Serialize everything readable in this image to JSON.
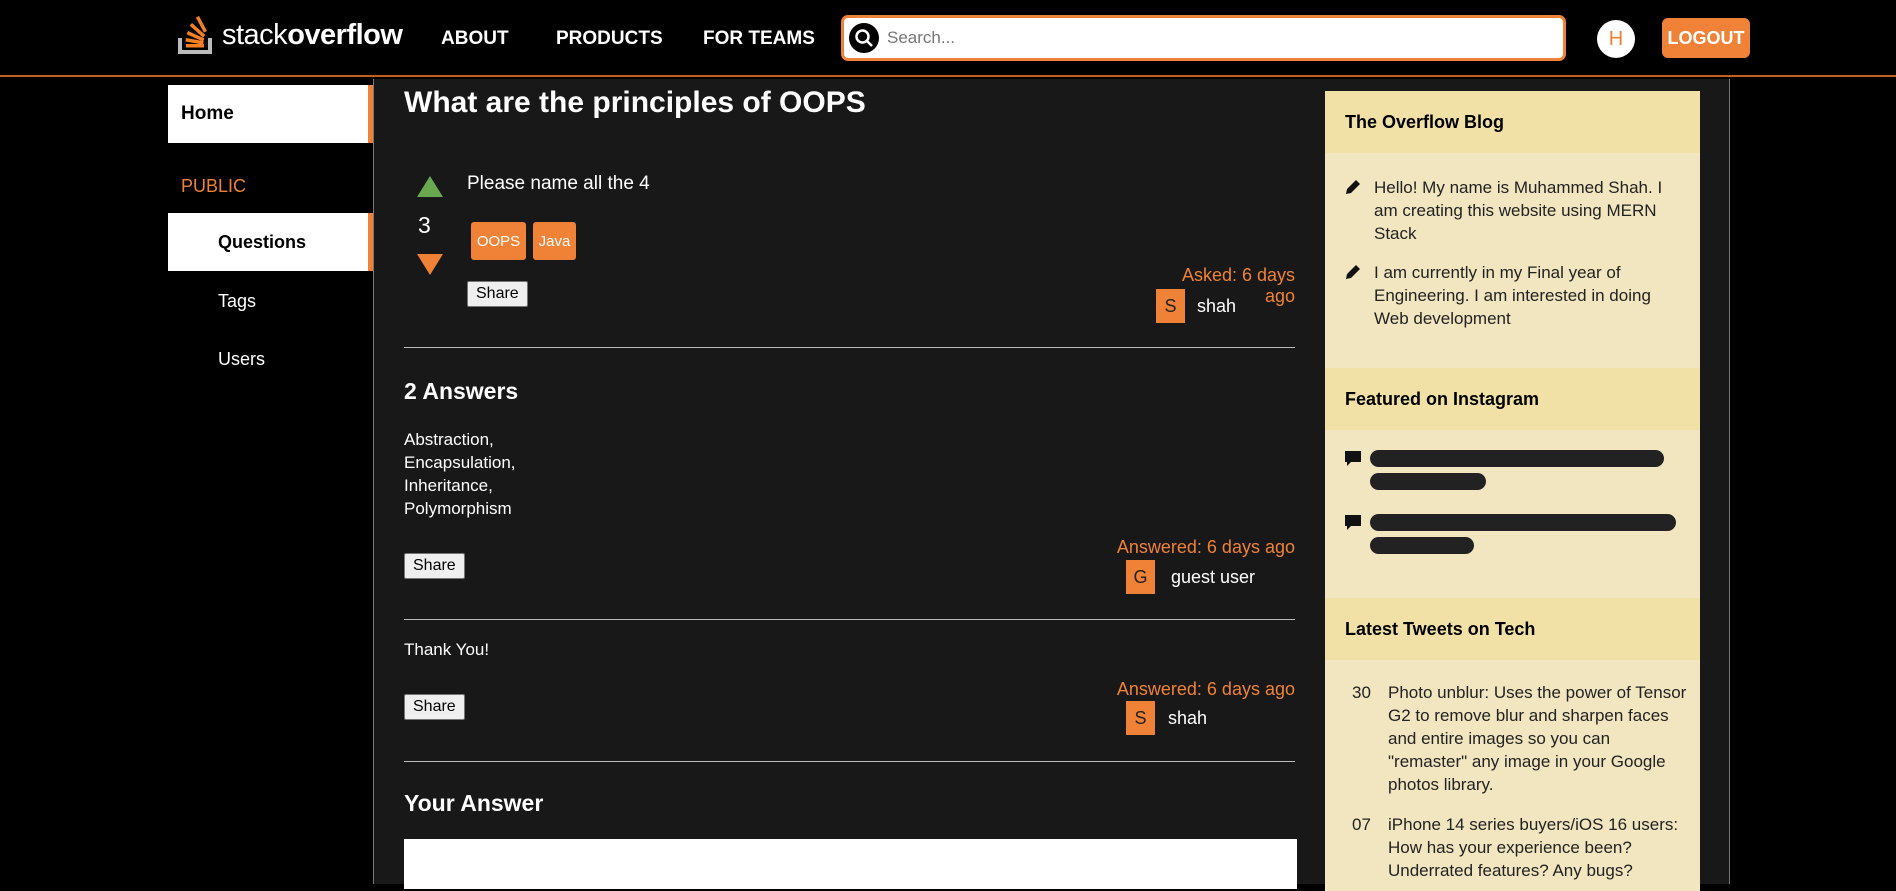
{
  "header": {
    "logo_light": "stack",
    "logo_bold": "overflow",
    "nav": [
      "ABOUT",
      "PRODUCTS",
      "FOR TEAMS"
    ],
    "search_placeholder": "Search...",
    "avatar_letter": "H",
    "logout_label": "LOGOUT"
  },
  "sidebar": {
    "home": "Home",
    "public": "PUBLIC",
    "questions": "Questions",
    "tags": "Tags",
    "users": "Users"
  },
  "question": {
    "title": "What are the principles of OOPS",
    "votes": "3",
    "body": "Please name all the 4",
    "tags": [
      "OOPS",
      "Java"
    ],
    "share_label": "Share",
    "asked": "Asked: 6 days ago",
    "author_initial": "S",
    "author": "shah"
  },
  "answers": {
    "heading": "2 Answers",
    "items": [
      {
        "lines": [
          "Abstraction,",
          "Encapsulation,",
          "Inheritance,",
          "Polymorphism"
        ],
        "share_label": "Share",
        "answered": "Answered: 6 days ago",
        "author_initial": "G",
        "author": "guest user"
      },
      {
        "lines": [
          "Thank You!"
        ],
        "share_label": "Share",
        "answered": "Answered: 6 days ago",
        "author_initial": "S",
        "author": "shah"
      }
    ]
  },
  "your_answer": {
    "heading": "Your Answer"
  },
  "right_sidebar": {
    "blog_heading": "The Overflow Blog",
    "blog_items": [
      "Hello! My name is Muhammed Shah. I am creating this website using MERN Stack",
      "I am currently in my Final year of Engineering. I am interested in doing Web development"
    ],
    "instagram_heading": "Featured on Instagram",
    "tweets_heading": "Latest Tweets on Tech",
    "tweets": [
      {
        "num": "30",
        "text": "Photo unblur: Uses the power of Tensor G2 to remove blur and sharpen faces and entire images so you can \"remaster\" any image in your Google photos library."
      },
      {
        "num": "07",
        "text": "iPhone 14 series buyers/iOS 16 users: How has your experience been? Underrated features? Any bugs?"
      }
    ]
  },
  "colors": {
    "accent": "#ef8236",
    "upvote": "#6aa84f",
    "panel_bg": "#181818",
    "sidebar_widget_bg": "#f1e6c0",
    "sidebar_widget_header": "#f1e1a6"
  }
}
